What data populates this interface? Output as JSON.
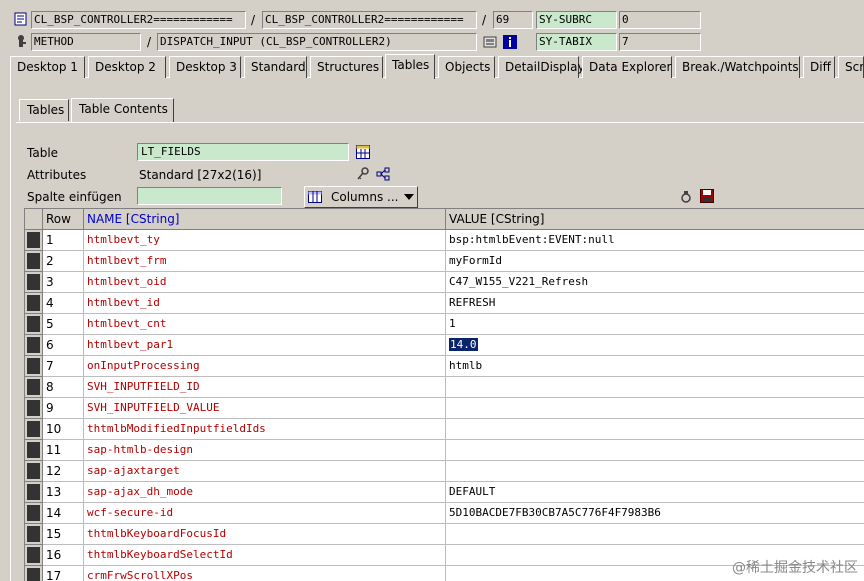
{
  "header": {
    "row1": {
      "program": "CL_BSP_CONTROLLER2============",
      "include": "CL_BSP_CONTROLLER2============",
      "line": "69",
      "sysvar_name": "SY-SUBRC",
      "sysvar_value": "0"
    },
    "row2": {
      "event_type": "METHOD",
      "event": "DISPATCH_INPUT (CL_BSP_CONTROLLER2)",
      "sysvar_name": "SY-TABIX",
      "sysvar_value": "7"
    }
  },
  "tabs": [
    {
      "label": "Desktop 1"
    },
    {
      "label": "Desktop 2"
    },
    {
      "label": "Desktop 3"
    },
    {
      "label": "Standard"
    },
    {
      "label": "Structures"
    },
    {
      "label": "Tables"
    },
    {
      "label": "Objects"
    },
    {
      "label": "DetailDisplay"
    },
    {
      "label": "Data Explorer"
    },
    {
      "label": "Break./Watchpoints"
    },
    {
      "label": "Diff"
    },
    {
      "label": "Script"
    }
  ],
  "inner_tabs": [
    {
      "label": "Tables"
    },
    {
      "label": "Table Contents"
    }
  ],
  "form": {
    "table_label": "Table",
    "table_value": "LT_FIELDS",
    "attributes_label": "Attributes",
    "attributes_value": "Standard [27x2(16)]",
    "insert_col_label": "Spalte einfügen",
    "insert_col_value": "",
    "columns_button": "Columns ..."
  },
  "grid": {
    "columns": [
      "Row",
      "NAME [CString]",
      "VALUE [CString]"
    ],
    "rows": [
      {
        "row": "1",
        "name": "htmlbevt_ty",
        "value": "bsp:htmlbEvent:EVENT:null"
      },
      {
        "row": "2",
        "name": "htmlbevt_frm",
        "value": "myFormId"
      },
      {
        "row": "3",
        "name": "htmlbevt_oid",
        "value": "C47_W155_V221_Refresh"
      },
      {
        "row": "4",
        "name": "htmlbevt_id",
        "value": "REFRESH"
      },
      {
        "row": "5",
        "name": "htmlbevt_cnt",
        "value": "1"
      },
      {
        "row": "6",
        "name": "htmlbevt_par1",
        "value": "14.0"
      },
      {
        "row": "7",
        "name": "onInputProcessing",
        "value": "htmlb"
      },
      {
        "row": "8",
        "name": "SVH_INPUTFIELD_ID",
        "value": ""
      },
      {
        "row": "9",
        "name": "SVH_INPUTFIELD_VALUE",
        "value": ""
      },
      {
        "row": "10",
        "name": "thtmlbModifiedInputfieldIds",
        "value": ""
      },
      {
        "row": "11",
        "name": "sap-htmlb-design",
        "value": ""
      },
      {
        "row": "12",
        "name": "sap-ajaxtarget",
        "value": ""
      },
      {
        "row": "13",
        "name": "sap-ajax_dh_mode",
        "value": "DEFAULT"
      },
      {
        "row": "14",
        "name": "wcf-secure-id",
        "value": "5D10BACDE7FB30CB7A5C776F4F7983B6"
      },
      {
        "row": "15",
        "name": "thtmlbKeyboardFocusId",
        "value": ""
      },
      {
        "row": "16",
        "name": "thtmlbKeyboardSelectId",
        "value": ""
      },
      {
        "row": "17",
        "name": "crmFrwScrollXPos",
        "value": ""
      }
    ]
  },
  "watermark": "@稀土掘金技术社区",
  "colors": {
    "background": "#d4d0c8",
    "field_green": "#c9e8cc",
    "name_red": "#b40000",
    "header_blue": "#0000c8",
    "selection": "#0a246a"
  },
  "icons": [
    "source-code-icon",
    "method-icon",
    "display-icon",
    "info-icon",
    "table-select-icon",
    "key-icon",
    "hierarchy-icon",
    "columns-icon",
    "dropdown-icon",
    "search-icon",
    "save-icon"
  ]
}
